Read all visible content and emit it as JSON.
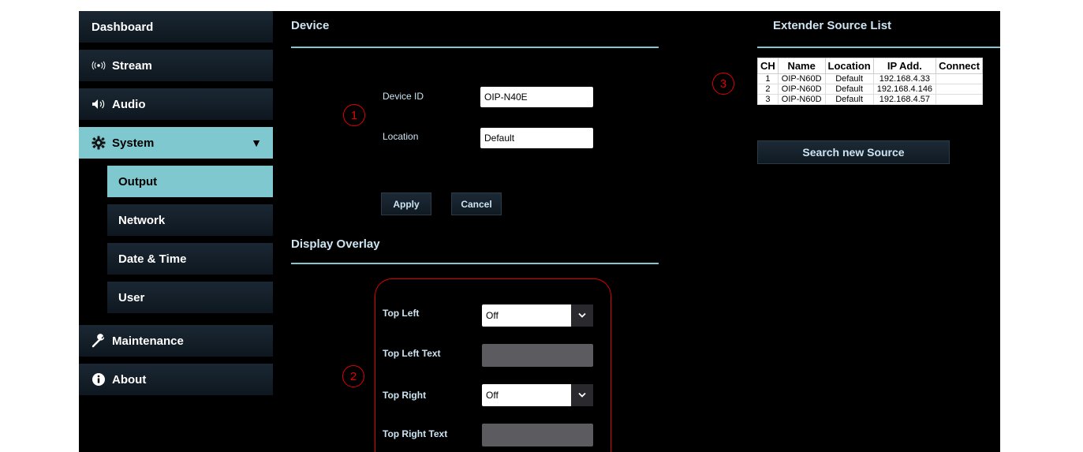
{
  "sidebar": {
    "dashboard": "Dashboard",
    "stream": "Stream",
    "audio": "Audio",
    "system": "System",
    "output": "Output",
    "network": "Network",
    "date_time": "Date & Time",
    "user": "User",
    "maintenance": "Maintenance",
    "about": "About"
  },
  "device": {
    "title": "Device",
    "device_id_label": "Device ID",
    "device_id_value": "OIP-N40E",
    "location_label": "Location",
    "location_value": "Default",
    "apply": "Apply",
    "cancel": "Cancel"
  },
  "overlay": {
    "title": "Display Overlay",
    "top_left_label": "Top Left",
    "top_left_value": "Off",
    "top_left_text_label": "Top Left Text",
    "top_right_label": "Top Right",
    "top_right_value": "Off",
    "top_right_text_label": "Top Right Text"
  },
  "extender": {
    "title": "Extender Source List",
    "headers": [
      "CH",
      "Name",
      "Location",
      "IP Add.",
      "Connect"
    ],
    "rows": [
      [
        "1",
        "OIP-N60D",
        "Default",
        "192.168.4.33",
        ""
      ],
      [
        "2",
        "OIP-N60D",
        "Default",
        "192.168.4.146",
        ""
      ],
      [
        "3",
        "OIP-N60D",
        "Default",
        "192.168.4.57",
        ""
      ]
    ],
    "search_button": "Search new Source"
  },
  "annotations": {
    "one": "1",
    "two": "2",
    "three": "3"
  },
  "colors": {
    "accent": "#7fc8d0",
    "annotation": "#e00000",
    "background": "#000000"
  }
}
